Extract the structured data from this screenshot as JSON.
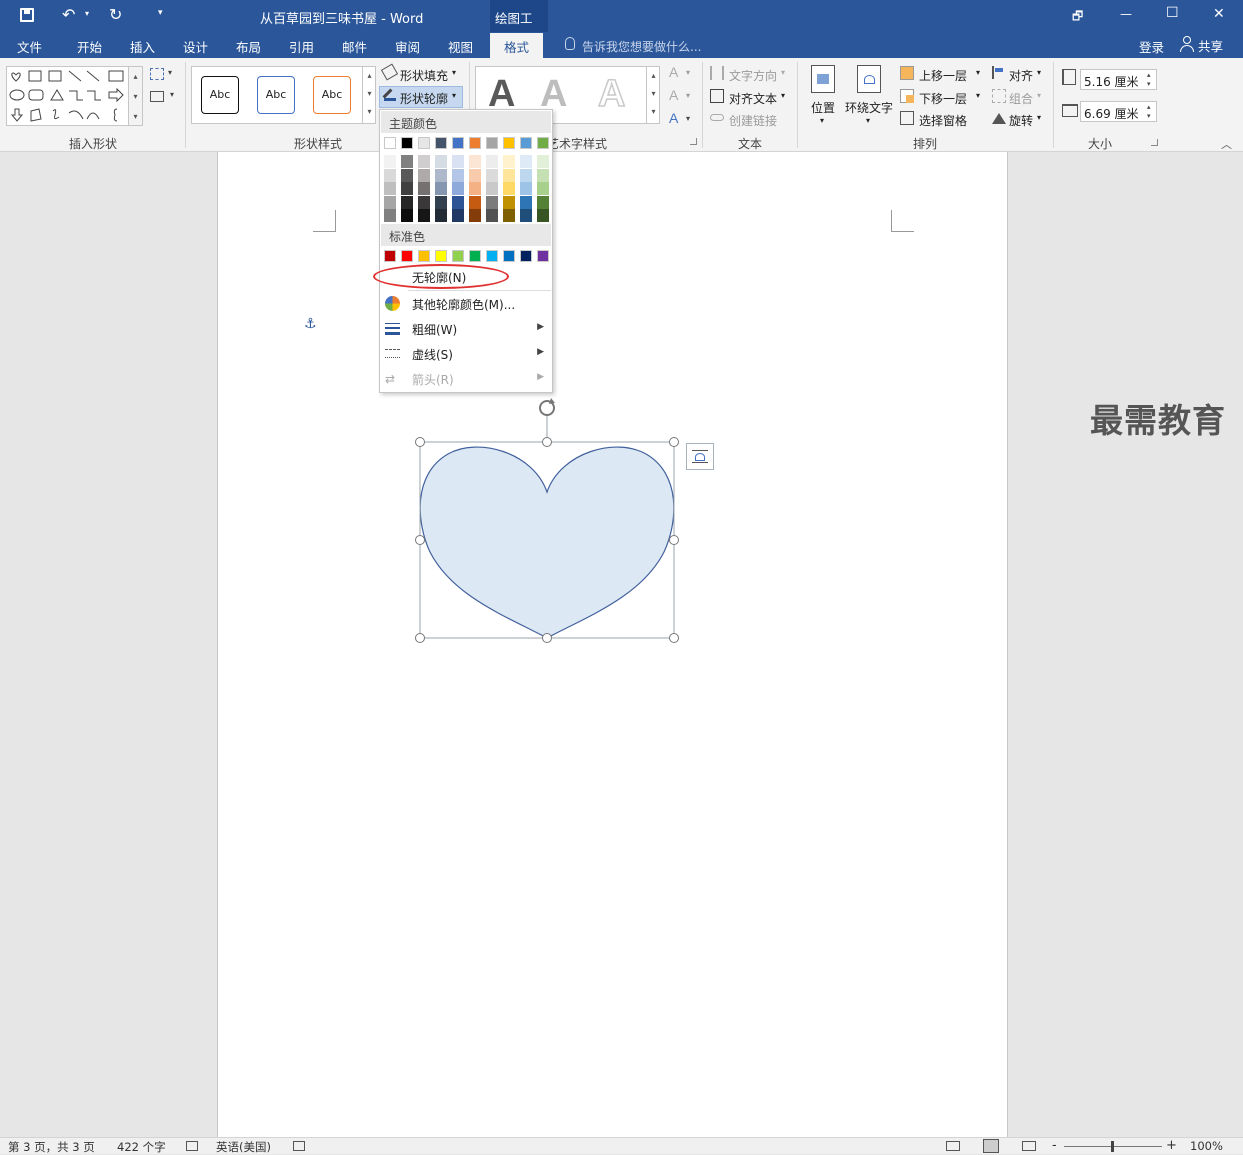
{
  "window": {
    "title": "从百草园到三味书屋 - Word",
    "context_tab": "绘图工具",
    "restore_label": "🗗",
    "minimize_label": "—",
    "maximize_label": "☐",
    "close_label": "✕"
  },
  "tabs": [
    {
      "label": "文件"
    },
    {
      "label": "开始"
    },
    {
      "label": "插入"
    },
    {
      "label": "设计"
    },
    {
      "label": "布局"
    },
    {
      "label": "引用"
    },
    {
      "label": "邮件"
    },
    {
      "label": "审阅"
    },
    {
      "label": "视图"
    },
    {
      "label": "格式"
    }
  ],
  "tell_me": "告诉我您想要做什么...",
  "account": {
    "login": "登录",
    "share": "共享"
  },
  "ribbon": {
    "groups": {
      "insert_shapes": "插入形状",
      "shape_styles": "形状样式",
      "wordart_styles": "艺术字样式",
      "text": "文本",
      "arrange": "排列",
      "size": "大小"
    },
    "style_sample": "Abc",
    "shape_fill": "形状填充",
    "shape_outline": "形状轮廓",
    "wordart_letter": "A",
    "text_direction": "文字方向",
    "align_text": "对齐文本",
    "create_link": "创建链接",
    "position": "位置",
    "wrap_text": "环绕文字",
    "bring_forward": "上移一层",
    "send_backward": "下移一层",
    "selection_pane": "选择窗格",
    "align": "对齐",
    "group": "组合",
    "rotate": "旋转",
    "height": "5.16 厘米",
    "width": "6.69 厘米"
  },
  "menu": {
    "theme_colors": "主题颜色",
    "standard_colors": "标准色",
    "no_outline": "无轮廓(N)",
    "more_colors": "其他轮廓颜色(M)...",
    "weight": "粗细(W)",
    "dashes": "虚线(S)",
    "arrows": "箭头(R)",
    "theme_top": [
      "#ffffff",
      "#000000",
      "#e7e6e6",
      "#44546a",
      "#4472c4",
      "#ed7d31",
      "#a5a5a5",
      "#ffc000",
      "#5b9bd5",
      "#70ad47"
    ],
    "theme_shades": [
      [
        "#f2f2f2",
        "#d9d9d9",
        "#bfbfbf",
        "#a6a6a6",
        "#808080"
      ],
      [
        "#808080",
        "#595959",
        "#404040",
        "#262626",
        "#0d0d0d"
      ],
      [
        "#d0cece",
        "#aeaaaa",
        "#757171",
        "#3a3838",
        "#171616"
      ],
      [
        "#d6dce4",
        "#adb9ca",
        "#8496b0",
        "#323f4f",
        "#222a35"
      ],
      [
        "#d9e2f3",
        "#b4c6e7",
        "#8eaadb",
        "#2f5496",
        "#1f3864"
      ],
      [
        "#fbe5d5",
        "#f7cbac",
        "#f4b183",
        "#c55a11",
        "#843c0b"
      ],
      [
        "#ededed",
        "#dbdbdb",
        "#c9c9c9",
        "#7b7b7b",
        "#525252"
      ],
      [
        "#fff2cc",
        "#fee599",
        "#ffd965",
        "#bf9000",
        "#7f6000"
      ],
      [
        "#deebf6",
        "#bdd7ee",
        "#9dc3e6",
        "#2e75b5",
        "#1e4e79"
      ],
      [
        "#e2efd9",
        "#c5e0b3",
        "#a8d08d",
        "#538135",
        "#375623"
      ]
    ],
    "standard": [
      "#c00000",
      "#ff0000",
      "#ffc000",
      "#ffff00",
      "#92d050",
      "#00b050",
      "#00b0f0",
      "#0070c0",
      "#002060",
      "#7030a0"
    ]
  },
  "shape": {
    "fill": "#dde8f5",
    "stroke": "#41609c"
  },
  "status": {
    "page": "第 3 页，共 3 页",
    "words": "422 个字",
    "language": "英语(美国)",
    "zoom": "100%",
    "zoom_minus": "-",
    "zoom_plus": "+"
  },
  "watermark": "最需教育"
}
